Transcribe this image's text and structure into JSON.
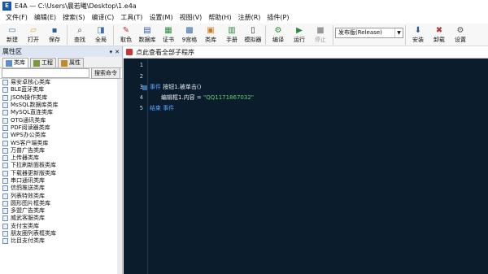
{
  "window": {
    "app_icon": "E",
    "title": "E4A — C:\\Users\\晨若曦\\Desktop\\1.e4a"
  },
  "menu": [
    "文件(F)",
    "编辑(E)",
    "搜索(S)",
    "编译(C)",
    "工具(T)",
    "设置(M)",
    "视图(V)",
    "帮助(H)",
    "注册(R)",
    "插件(P)"
  ],
  "toolbar": {
    "buttons": [
      {
        "label": "新建",
        "icon": "▭"
      },
      {
        "label": "打开",
        "icon": "▱"
      },
      {
        "label": "保存",
        "icon": "▪"
      },
      {
        "label": "查找",
        "icon": "⌕"
      },
      {
        "label": "全局",
        "icon": "◨"
      },
      {
        "label": "取色",
        "icon": "✎"
      },
      {
        "label": "数据库",
        "icon": "▤"
      },
      {
        "label": "证书",
        "icon": "▦"
      },
      {
        "label": "9宫格",
        "icon": "▩"
      },
      {
        "label": "类库",
        "icon": "▣"
      },
      {
        "label": "手册",
        "icon": "▥"
      },
      {
        "label": "模拟器",
        "icon": "▯"
      },
      {
        "label": "编译",
        "icon": "⚙"
      },
      {
        "label": "运行",
        "icon": "▶"
      },
      {
        "label": "停止",
        "icon": "■"
      },
      {
        "label": "安装",
        "icon": "⬇"
      },
      {
        "label": "卸载",
        "icon": "✖"
      },
      {
        "label": "设置",
        "icon": "⚙"
      }
    ],
    "build_mode": "发布版(Release)"
  },
  "left_panel": {
    "title": "属性区",
    "tabs": [
      "类库",
      "工程",
      "属性"
    ],
    "search_button": "搜索命令",
    "items": [
      "易安卓核心类库",
      "BLE蓝牙类库",
      "JSON操作类库",
      "MsSQL数据库类库",
      "MySQL直连类库",
      "OTG通讯类库",
      "PDF阅读器类库",
      "WPS办公类库",
      "WS客户端类库",
      "万普广告类库",
      "上传器类库",
      "下拉刷新面板类库",
      "下载器更新版类库",
      "串口通讯类库",
      "信鸽推送类库",
      "列表特效类库",
      "圆形图片框类库",
      "多盟广告类库",
      "威武客服类库",
      "支付宝类库",
      "朋友圈列表框类库",
      "比目支付类库"
    ]
  },
  "editor": {
    "header": "点此查看全部子程序",
    "line_numbers": [
      "1",
      "2",
      "3",
      "4",
      "5"
    ],
    "code": {
      "l3_kw": "事件",
      "l3_plain": "按钮1.被单击()",
      "l4_plain": "编辑框1.内容 = ",
      "l4_str": "\"QQ1171867032\"",
      "l5_kw": "结束 事件"
    }
  }
}
